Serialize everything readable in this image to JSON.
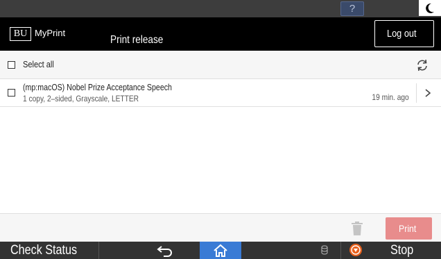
{
  "system_bar": {
    "help_label": "?",
    "help_icon": "question-icon",
    "night_mode_icon": "moon-icon"
  },
  "header": {
    "logo_text": "BU",
    "brand": "MyPrint",
    "title": "Print release",
    "logout_label": "Log out"
  },
  "toolbar": {
    "select_all_label": "Select all",
    "refresh_icon": "refresh-icon"
  },
  "jobs": [
    {
      "title": "(mp:macOS) Nobel Prize Acceptance Speech",
      "details": "1 copy, 2–sided, Grayscale, LETTER",
      "time": "19 min. ago"
    }
  ],
  "actions": {
    "delete_icon": "trash-icon",
    "print_label": "Print",
    "print_color": "#e88c8c"
  },
  "bottom_bar": {
    "check_status_label": "Check Status",
    "back_icon": "back-arrow-icon",
    "home_icon": "home-icon",
    "home_color": "#3a7bd5",
    "memory_icon": "memory-icon",
    "stop_icon": "stop-icon",
    "stop_label": "Stop"
  }
}
